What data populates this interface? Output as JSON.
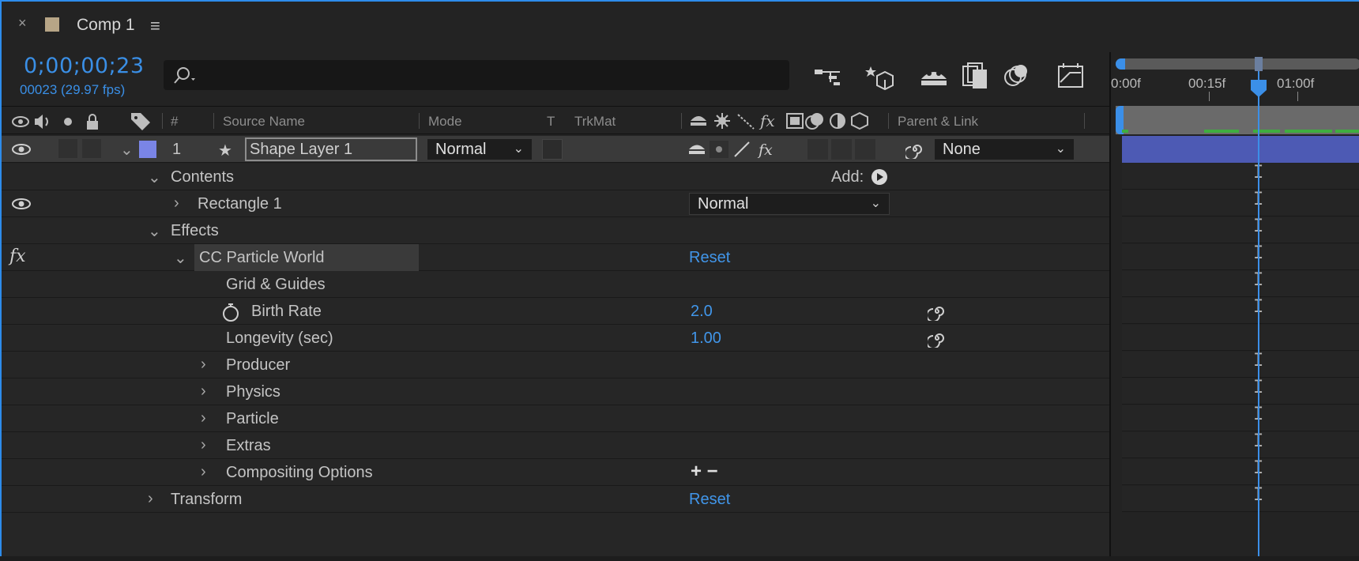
{
  "tab": {
    "close": "×",
    "title": "Comp 1",
    "menu": "≡",
    "swatch_color": "#b7a586"
  },
  "timecode": {
    "current": "0;00;00;23",
    "frames": "00023 (29.97 fps)"
  },
  "search": {
    "placeholder": ""
  },
  "toolbar": {
    "icons": [
      "draft-3d-icon",
      "shy-layers-icon",
      "frame-blending-icon",
      "motion-blur-icon",
      "graph-editor-icon",
      "comp-flowchart-icon"
    ]
  },
  "columns": {
    "hash": "#",
    "source_name": "Source Name",
    "mode": "Mode",
    "t": "T",
    "trkmat": "TrkMat",
    "parent_link": "Parent & Link"
  },
  "layer": {
    "number": "1",
    "name": "Shape Layer 1",
    "label_color": "#7a85e6",
    "mode": "Normal",
    "parent": "None"
  },
  "rows": {
    "contents": "Contents",
    "add": "Add:",
    "rectangle": "Rectangle 1",
    "rectangle_mode": "Normal",
    "effects": "Effects",
    "effect_name": "CC Particle World",
    "effect_reset": "Reset",
    "grid_guides": "Grid & Guides",
    "birth_rate": "Birth Rate",
    "birth_rate_value": "2.0",
    "longevity": "Longevity (sec)",
    "longevity_value": "1.00",
    "producer": "Producer",
    "physics": "Physics",
    "particle": "Particle",
    "extras": "Extras",
    "compositing": "Compositing Options",
    "plus_minus": "+ −",
    "transform": "Transform",
    "transform_reset": "Reset",
    "fx": "fx"
  },
  "timeline": {
    "ticks": [
      "0:00f",
      "00:15f",
      "01:00f"
    ],
    "accent": "#3b8fe8",
    "layer_bar_color": "#4d5ab4"
  }
}
